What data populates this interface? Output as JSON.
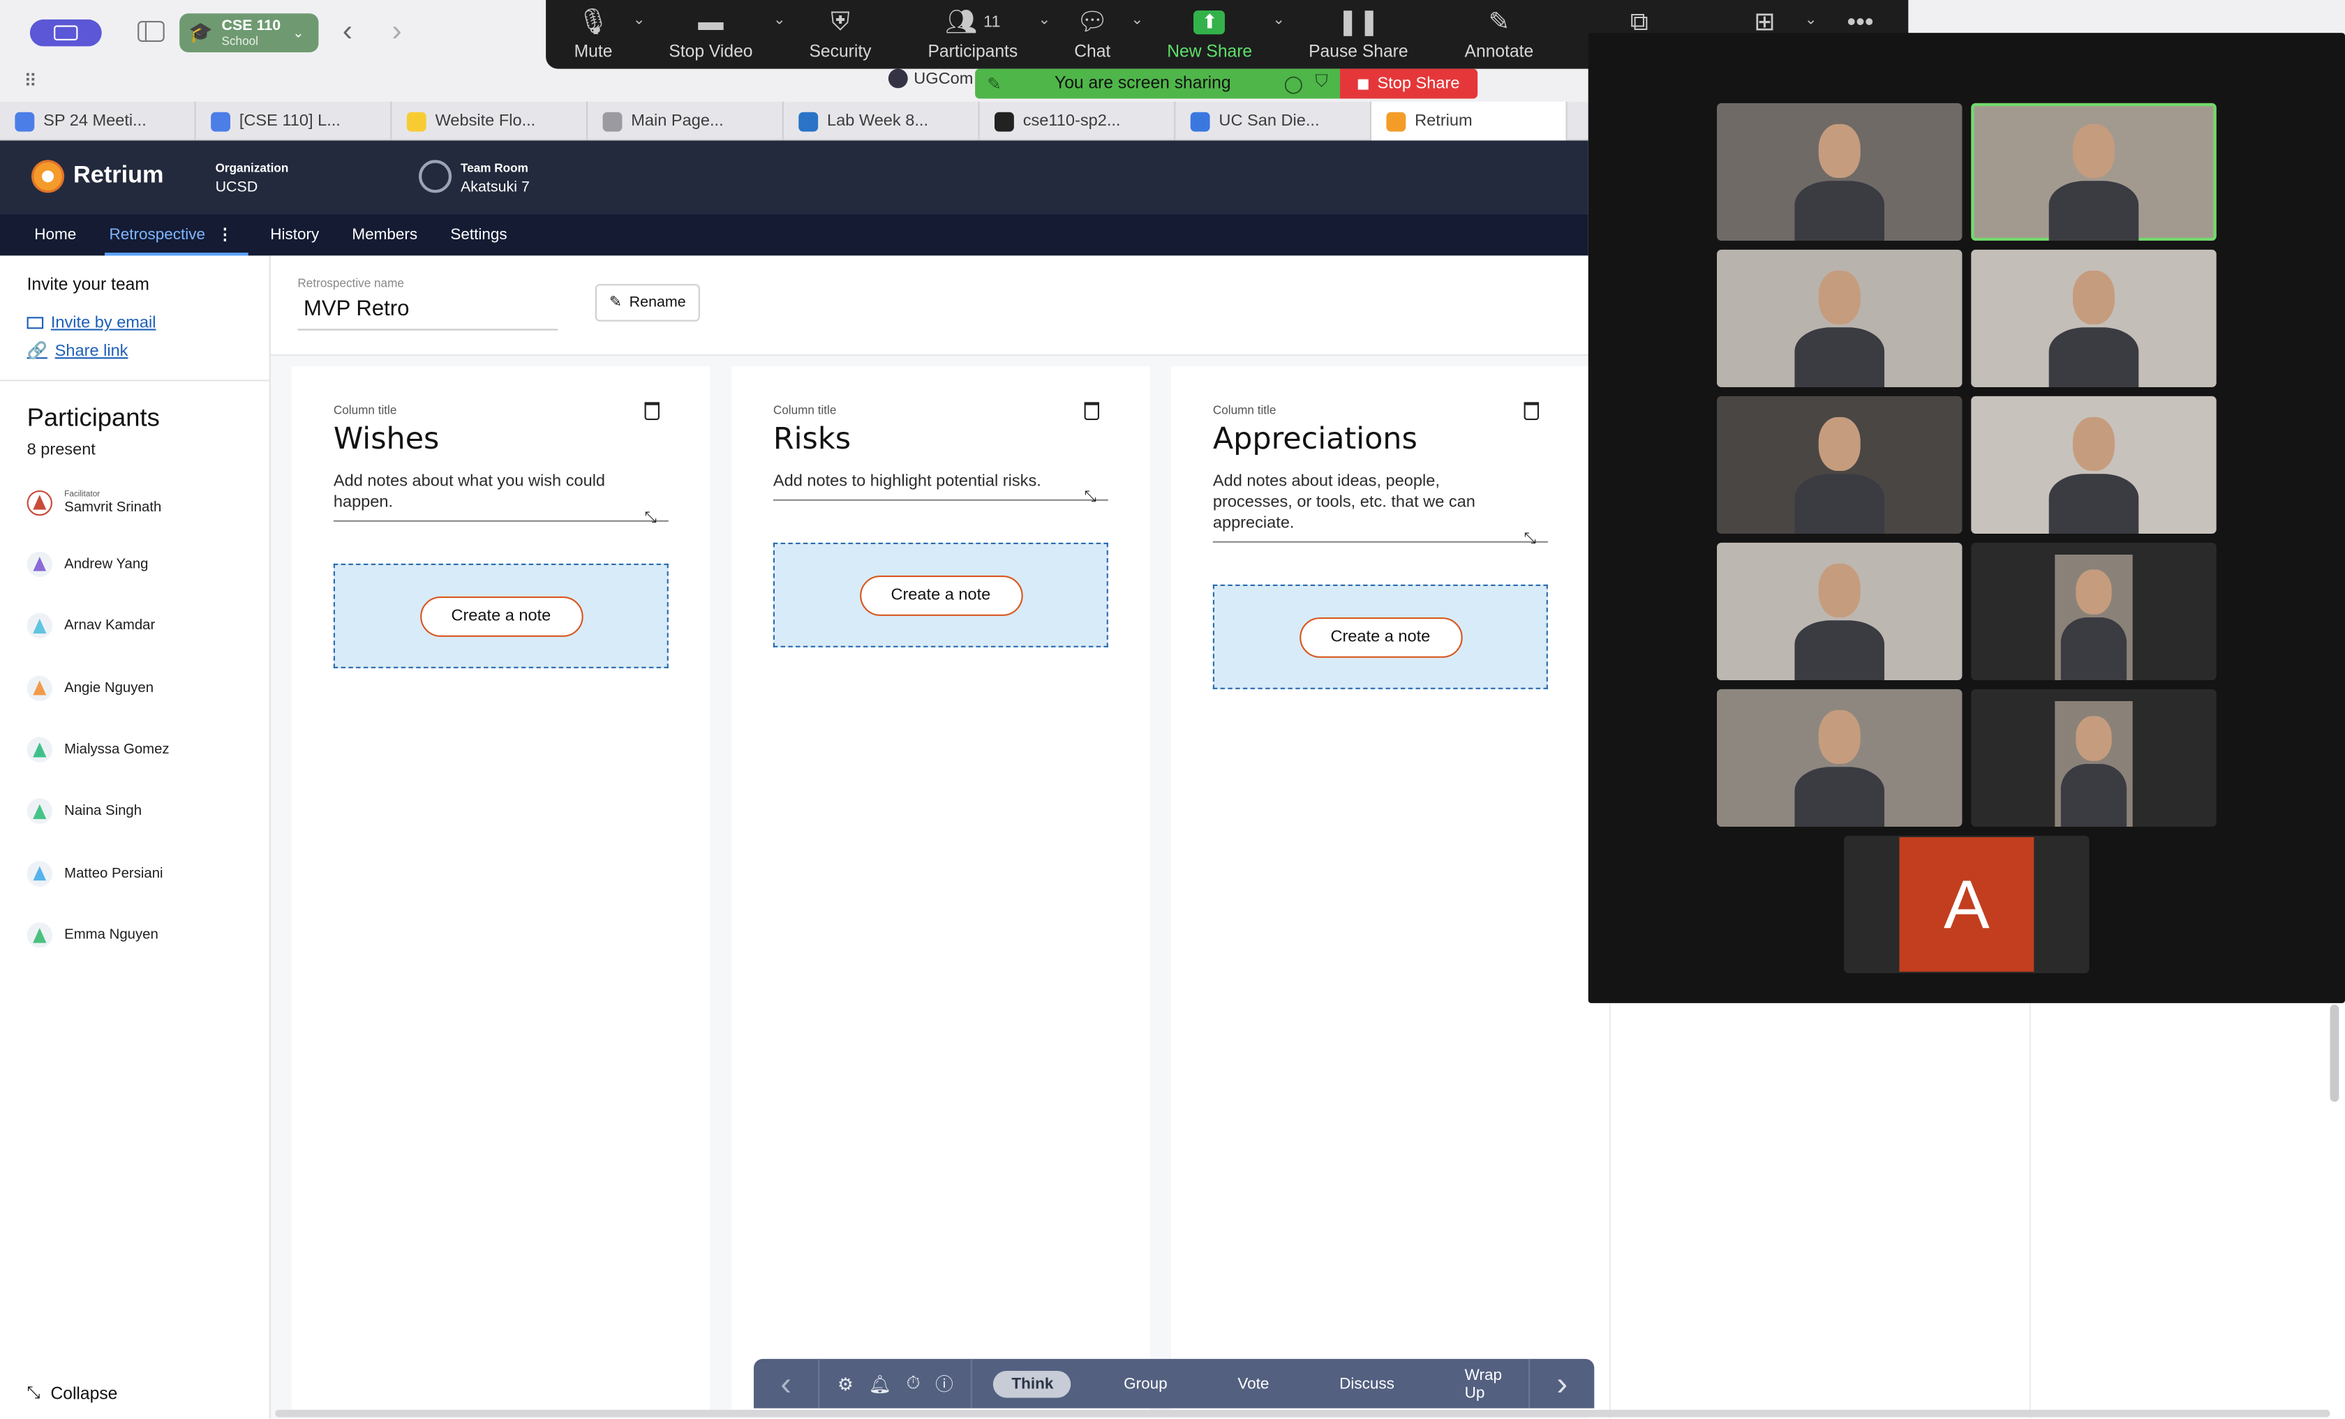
{
  "browser": {
    "profile_name": "CSE 110",
    "profile_sub": "School",
    "tabs": [
      {
        "label": "SP 24 Meeti...",
        "icon": "docs-icon",
        "color": "#4c7ee8"
      },
      {
        "label": "[CSE 110] L...",
        "icon": "docs-icon",
        "color": "#4c7ee8"
      },
      {
        "label": "Website Flo...",
        "icon": "miro-icon",
        "color": "#f7cc33"
      },
      {
        "label": "Main Page...",
        "icon": "figma-icon",
        "color": "#9a9aa0"
      },
      {
        "label": "Lab Week 8...",
        "icon": "canvas-icon",
        "color": "#2a73c7"
      },
      {
        "label": "cse110-sp2...",
        "icon": "github-icon",
        "color": "#222222"
      },
      {
        "label": "UC San Die...",
        "icon": "calendar-icon",
        "color": "#3a78e0"
      },
      {
        "label": "Retrium",
        "icon": "retrium-icon",
        "color": "#f39d28"
      }
    ],
    "address_fragment": "UGCom"
  },
  "zoom": {
    "toolbar": [
      {
        "id": "mute",
        "label": "Mute",
        "caret": true
      },
      {
        "id": "stop-video",
        "label": "Stop Video",
        "caret": true
      },
      {
        "id": "security",
        "label": "Security",
        "caret": false
      },
      {
        "id": "participants",
        "label": "Participants",
        "caret": true,
        "count": "11"
      },
      {
        "id": "chat",
        "label": "Chat",
        "caret": true
      },
      {
        "id": "new-share",
        "label": "New Share",
        "caret": true,
        "highlight": true
      },
      {
        "id": "pause-share",
        "label": "Pause Share",
        "caret": false
      },
      {
        "id": "annotate",
        "label": "Annotate",
        "caret": false
      },
      {
        "id": "slide-control",
        "label": "Slide Control",
        "caret": false
      },
      {
        "id": "apps",
        "label": "Apps",
        "caret": true
      },
      {
        "id": "more",
        "label": "More",
        "caret": false
      }
    ],
    "sharing_text": "You are screen sharing",
    "stop_share": "Stop Share",
    "gallery": {
      "avatar_letter": "A",
      "avatar_color": "#c23e1e",
      "active_color": "#74d86b"
    }
  },
  "retrium": {
    "brand": "Retrium",
    "org_label": "Organization",
    "org_value": "UCSD",
    "room_label": "Team Room",
    "room_value": "Akatsuki 7",
    "nav": [
      "Home",
      "Retrospective",
      "History",
      "Members",
      "Settings"
    ],
    "sidebar": {
      "invite_title": "Invite your team",
      "invite_email": "Invite by email",
      "share_link": "Share link",
      "participants_title": "Participants",
      "present_count": "8 present",
      "facilitator_tag": "Facilitator",
      "participants": [
        {
          "name": "Samvrit Srinath",
          "color": "#c84b3a",
          "facilitator": true
        },
        {
          "name": "Andrew Yang",
          "color": "#8a6ad6"
        },
        {
          "name": "Arnav Kamdar",
          "color": "#5fc4e0"
        },
        {
          "name": "Angie Nguyen",
          "color": "#f29a4a"
        },
        {
          "name": "Mialyssa Gomez",
          "color": "#3fc08a"
        },
        {
          "name": "Naina Singh",
          "color": "#46c386"
        },
        {
          "name": "Matteo Persiani",
          "color": "#56b3ea"
        },
        {
          "name": "Emma Nguyen",
          "color": "#4bc07f"
        }
      ],
      "collapse": "Collapse"
    },
    "retro": {
      "name_label": "Retrospective name",
      "name_value": "MVP Retro",
      "rename": "Rename"
    },
    "columns": [
      {
        "label": "Column title",
        "title": "Wishes",
        "desc": "Add notes about what you wish could happen.",
        "cta": "Create a note"
      },
      {
        "label": "Column title",
        "title": "Risks",
        "desc": "Add notes to highlight potential risks.",
        "cta": "Create a note"
      },
      {
        "label": "Column title",
        "title": "Appreciations",
        "desc": "Add notes about ideas, people, processes, or tools, etc. that we can appreciate.",
        "cta": "Create a note"
      }
    ],
    "phases": [
      "Think",
      "Group",
      "Vote",
      "Discuss",
      "Wrap Up"
    ],
    "active_phase": "Think"
  }
}
